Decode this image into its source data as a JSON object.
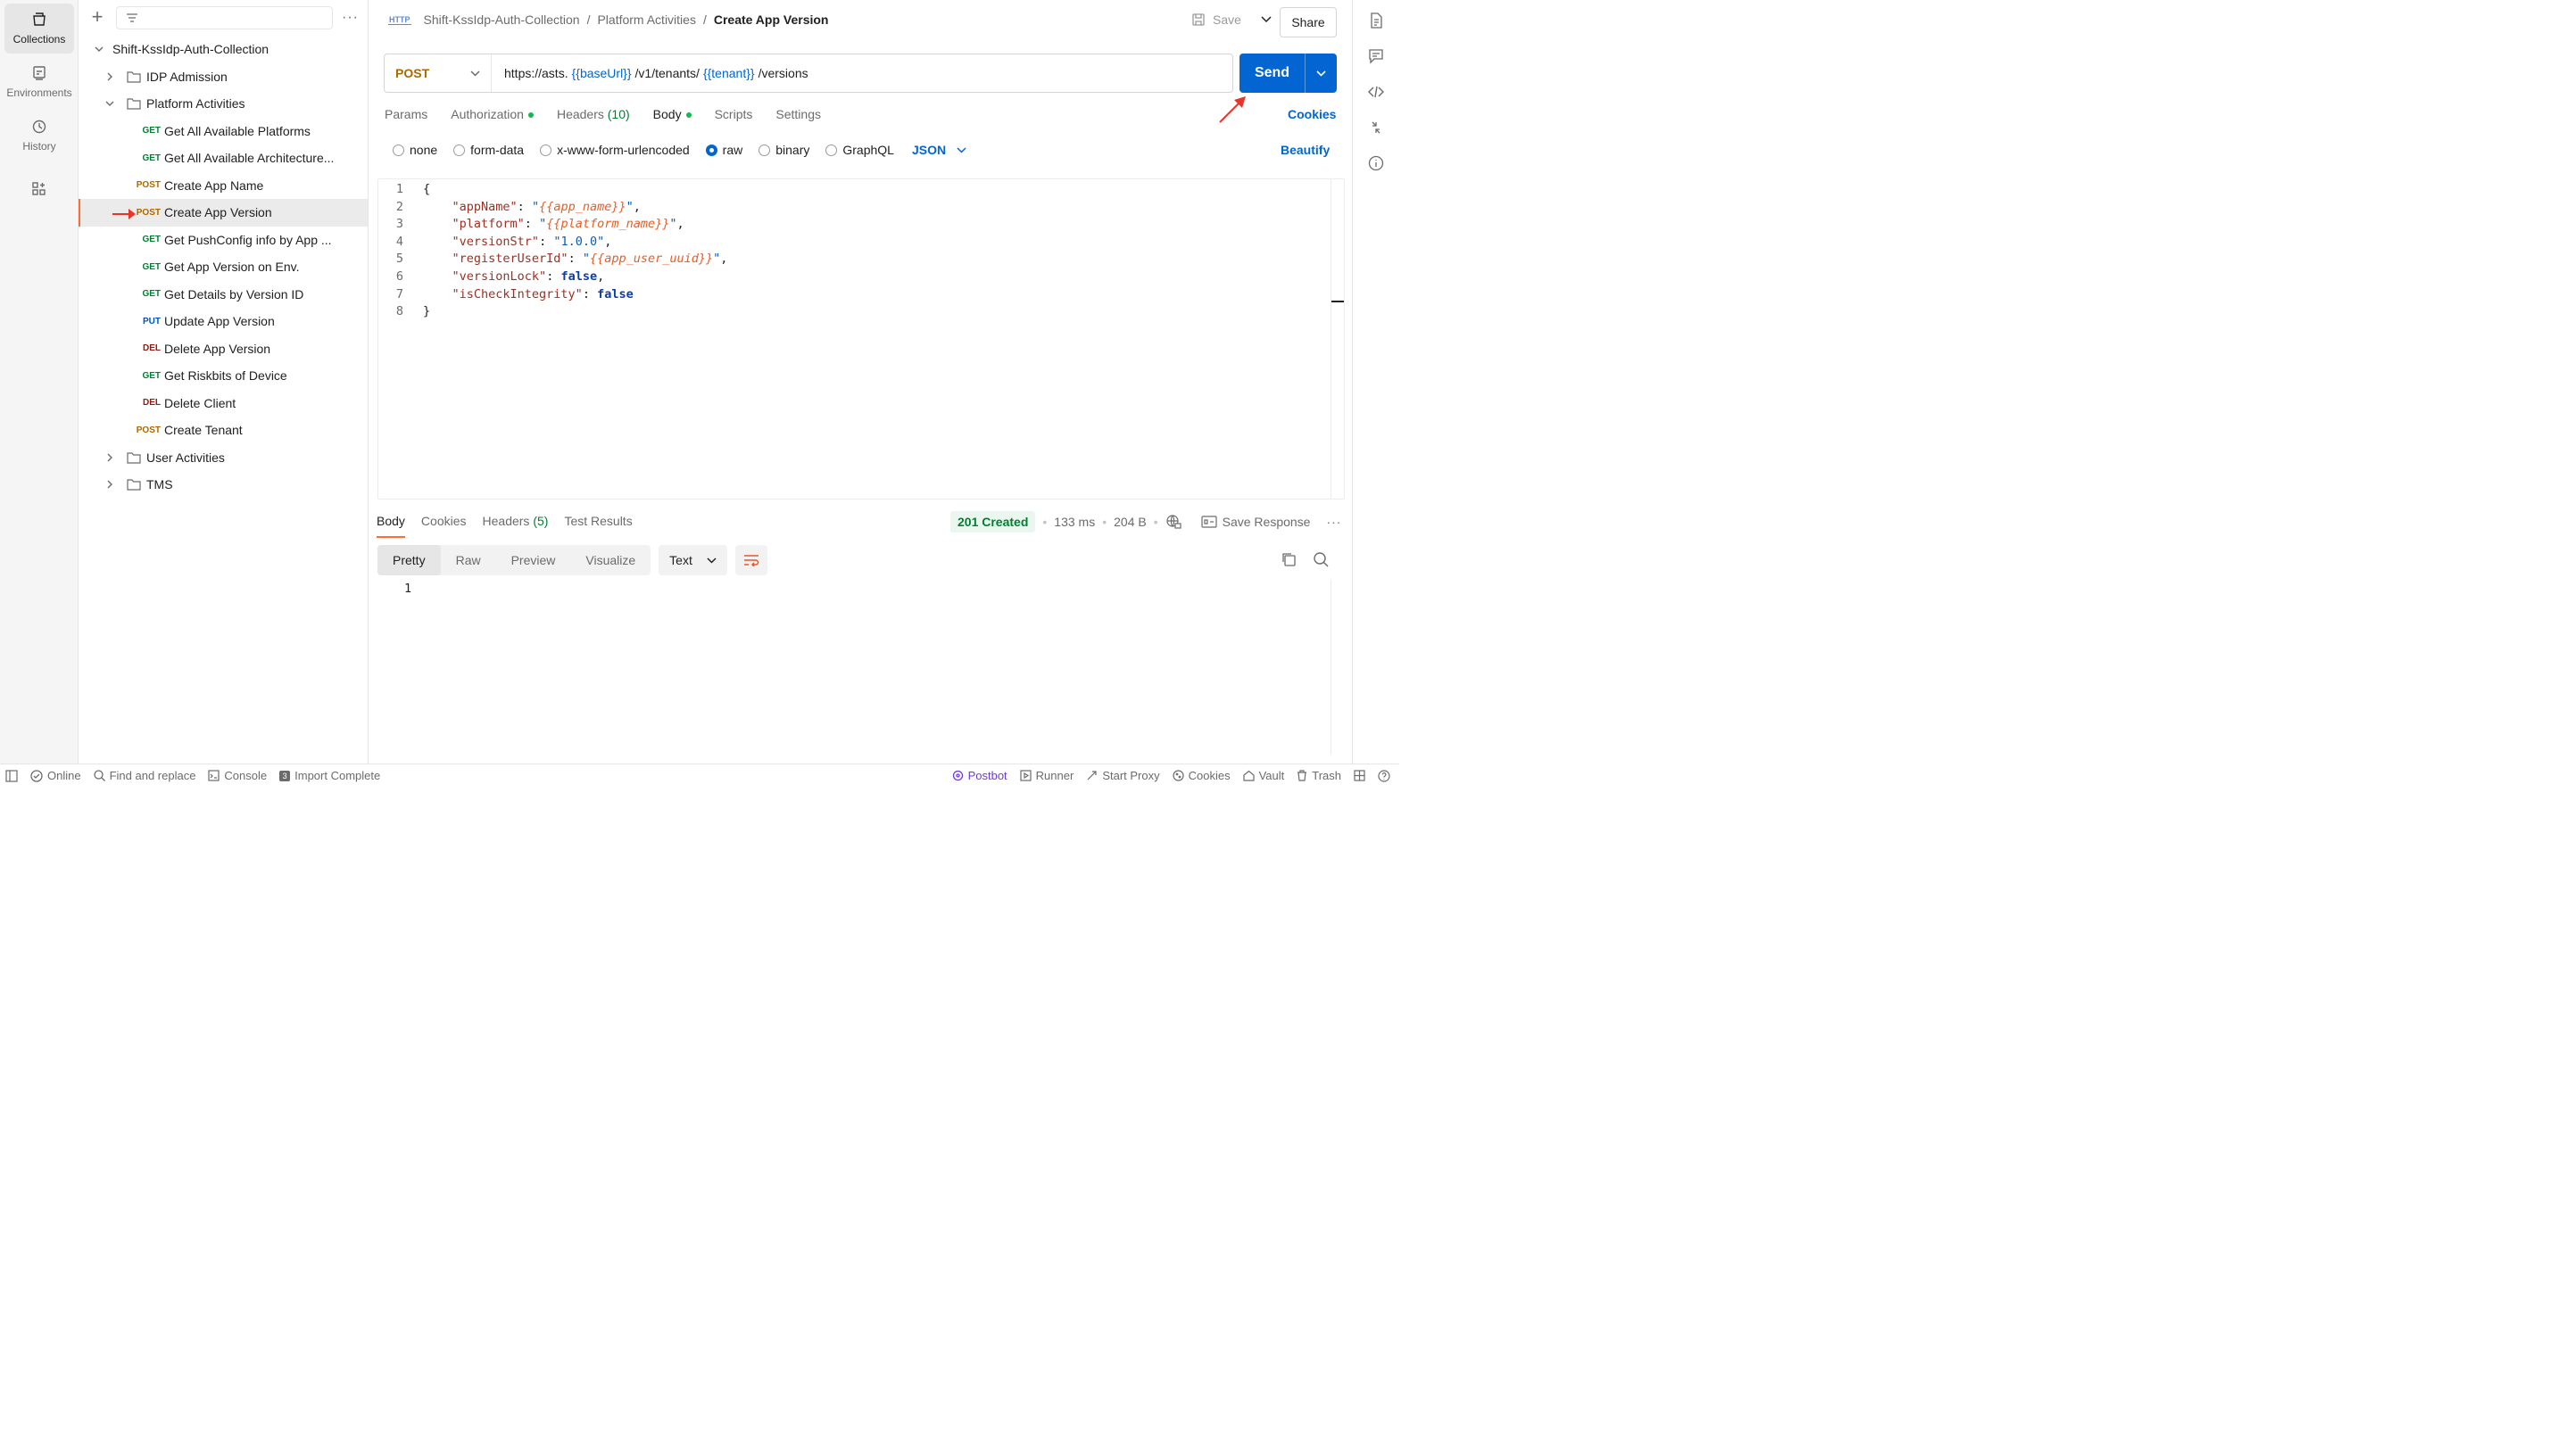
{
  "rail": {
    "items": [
      {
        "label": "Collections",
        "icon": "collections-icon",
        "active": true
      },
      {
        "label": "Environments",
        "icon": "environments-icon"
      },
      {
        "label": "History",
        "icon": "history-icon"
      },
      {
        "label": "",
        "icon": "apps-icon"
      }
    ]
  },
  "sidebar": {
    "collection_name": "Shift-KssIdp-Auth-Collection",
    "folders": {
      "idp": "IDP Admission",
      "platform": "Platform Activities",
      "user": "User Activities",
      "tms": "TMS"
    },
    "requests": [
      {
        "method": "GET",
        "name": "Get All Available Platforms"
      },
      {
        "method": "GET",
        "name": "Get All Available Architecture..."
      },
      {
        "method": "POST",
        "name": "Create App Name"
      },
      {
        "method": "POST",
        "name": "Create App Version"
      },
      {
        "method": "GET",
        "name": "Get PushConfig info by App ..."
      },
      {
        "method": "GET",
        "name": "Get App Version on Env."
      },
      {
        "method": "GET",
        "name": "Get Details by Version ID"
      },
      {
        "method": "PUT",
        "name": "Update App Version"
      },
      {
        "method": "DEL",
        "name": "Delete App Version"
      },
      {
        "method": "GET",
        "name": "Get Riskbits of Device"
      },
      {
        "method": "DEL",
        "name": "Delete Client"
      },
      {
        "method": "POST",
        "name": "Create Tenant"
      }
    ]
  },
  "header": {
    "breadcrumb": [
      "Shift-KssIdp-Auth-Collection",
      "Platform Activities",
      "Create App Version"
    ],
    "http_icon": "HTTP",
    "save_label": "Save",
    "share_label": "Share"
  },
  "request": {
    "method": "POST",
    "url_parts": [
      "https://asts.",
      "{{baseUrl}}",
      "/v1/tenants/",
      "{{tenant}}",
      "/versions"
    ],
    "send_label": "Send"
  },
  "req_tabs": {
    "params": "Params",
    "authorization": "Authorization",
    "headers": "Headers",
    "headers_count": "(10)",
    "body": "Body",
    "scripts": "Scripts",
    "settings": "Settings",
    "cookies": "Cookies"
  },
  "body_options": {
    "none": "none",
    "form_data": "form-data",
    "urlencoded": "x-www-form-urlencoded",
    "raw": "raw",
    "binary": "binary",
    "graphql": "GraphQL",
    "format": "JSON",
    "beautify": "Beautify"
  },
  "code": {
    "line_numbers": [
      "1",
      "2",
      "3",
      "4",
      "5",
      "6",
      "7",
      "8"
    ],
    "open": "{",
    "close": "}",
    "fields": [
      {
        "key": "\"appName\"",
        "value": "{{app_name}}"
      },
      {
        "key": "\"platform\"",
        "value": "{{platform_name}}"
      },
      {
        "key": "\"versionStr\"",
        "value": "\"1.0.0\""
      },
      {
        "key": "\"registerUserId\"",
        "value": "{{app_user_uuid}}"
      },
      {
        "key": "\"versionLock\"",
        "value": "false"
      },
      {
        "key": "\"isCheckIntegrity\"",
        "value": "false"
      }
    ]
  },
  "response": {
    "tabs": {
      "body": "Body",
      "cookies": "Cookies",
      "headers": "Headers",
      "headers_count": "(5)",
      "tests": "Test Results"
    },
    "status": "201 Created",
    "time": "133 ms",
    "size": "204 B",
    "save_response": "Save Response",
    "views": {
      "pretty": "Pretty",
      "raw": "Raw",
      "preview": "Preview",
      "visualize": "Visualize"
    },
    "text_format": "Text",
    "line1": "1"
  },
  "statusbar": {
    "online": "Online",
    "find_replace": "Find and replace",
    "console": "Console",
    "import_badge": "3",
    "import": "Import Complete",
    "postbot": "Postbot",
    "runner": "Runner",
    "start_proxy": "Start Proxy",
    "cookies": "Cookies",
    "vault": "Vault",
    "trash": "Trash"
  }
}
